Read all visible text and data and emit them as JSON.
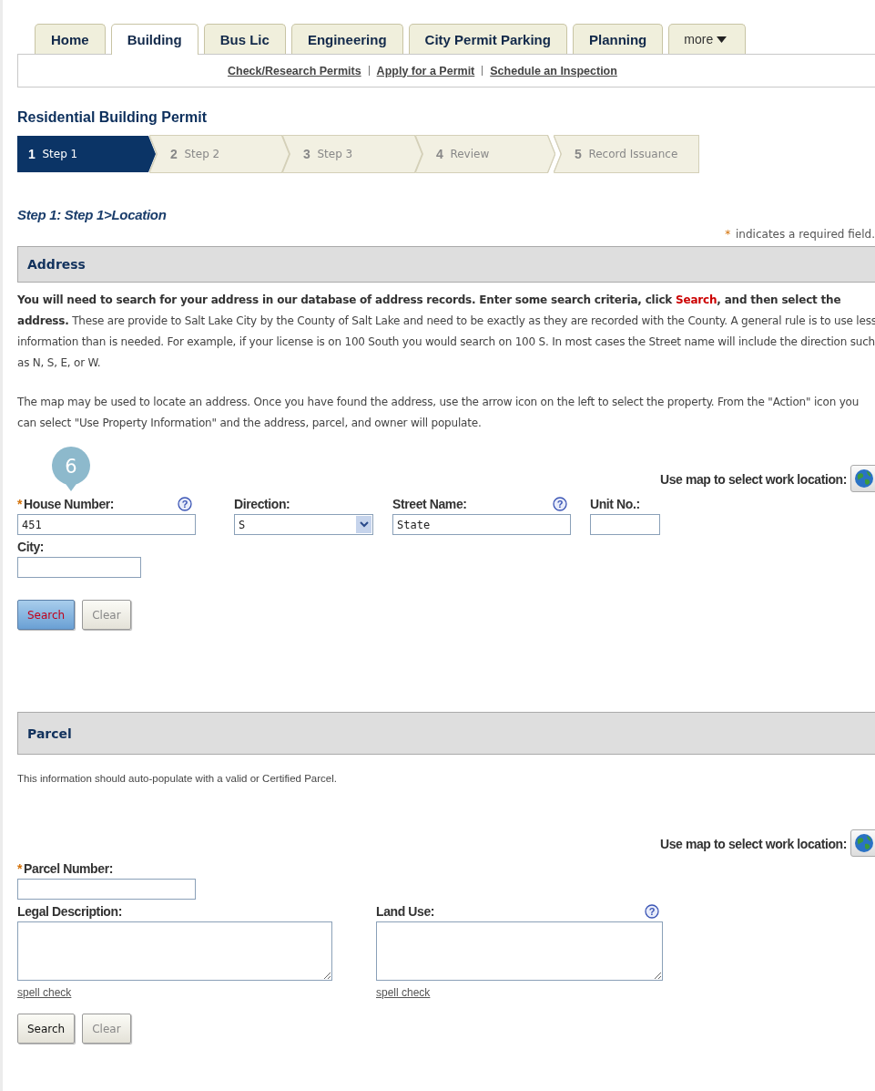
{
  "tabs": [
    {
      "label": "Home",
      "selected": false,
      "dropdown": false
    },
    {
      "label": "Building",
      "selected": true,
      "dropdown": false
    },
    {
      "label": "Bus Lic",
      "selected": false,
      "dropdown": false
    },
    {
      "label": "Engineering",
      "selected": false,
      "dropdown": false
    },
    {
      "label": "City Permit Parking",
      "selected": false,
      "dropdown": false
    },
    {
      "label": "Planning",
      "selected": false,
      "dropdown": false
    },
    {
      "label": "more",
      "selected": false,
      "dropdown": true
    }
  ],
  "sub_links": [
    "Check/Research Permits",
    "Apply for a Permit",
    "Schedule an Inspection"
  ],
  "page_title": "Residential Building Permit",
  "steps": [
    {
      "number": "1",
      "label": "Step 1",
      "selected": true
    },
    {
      "number": "2",
      "label": "Step 2",
      "selected": false
    },
    {
      "number": "3",
      "label": "Step 3",
      "selected": false
    },
    {
      "number": "4",
      "label": "Review",
      "selected": false
    },
    {
      "number": "5",
      "label": "Record Issuance",
      "selected": false
    }
  ],
  "step_heading": "Step 1: Step 1>Location",
  "required_note": {
    "mark": "*",
    "text": "indicates a required field."
  },
  "address": {
    "title": "Address",
    "paragraphs": [
      [
        {
          "text": "You will need to search for your address in our database of address records. Enter some search criteria, click ",
          "kind": "strong"
        },
        {
          "text": "Search",
          "kind": "alert"
        },
        {
          "text": ", and then select the address.",
          "kind": "strong"
        },
        {
          "text": " These are provide to Salt Lake City by the County of Salt Lake and need to be exactly as they are recorded with the County. A general rule is to use less information than is needed. For example, if your license is on 100 South you would search on 100 S. In most cases the Street name will include the direction such as N, S, E, or W.",
          "kind": "normal"
        }
      ],
      [
        {
          "text": "The map may be used to locate an address. Once you have found the address, use the arrow icon on the left to select the property. From the \"Action\" icon you can select \"Use Property Information\" and the address, parcel, and owner will populate.",
          "kind": "normal"
        }
      ]
    ],
    "badge": "6",
    "map_link": "Use map to select work location:",
    "rows": [
      [
        {
          "label": "House Number:",
          "required": true,
          "help": "?",
          "kind": "text",
          "value": "451"
        },
        {
          "label": "Direction:",
          "required": false,
          "kind": "select",
          "value": "S"
        },
        {
          "label": "Street Name:",
          "required": false,
          "help": "?",
          "kind": "text",
          "value": "State"
        },
        {
          "label": "Unit No.:",
          "required": false,
          "kind": "text"
        }
      ],
      [
        {
          "label": "City:",
          "required": false,
          "kind": "text"
        }
      ]
    ],
    "buttons": [
      {
        "label": "Search",
        "highlighted": true
      },
      {
        "label": "Clear",
        "highlighted": false
      }
    ]
  },
  "parcel": {
    "title": "Parcel",
    "note": "This information should auto-populate with a valid or Certified Parcel.",
    "map_link": "Use map to select work location:",
    "rows": [
      [
        {
          "label": "Parcel Number:",
          "required": true,
          "kind": "text"
        }
      ],
      [
        {
          "label": "Legal Description:",
          "required": false,
          "kind": "textarea",
          "spell_check": "spell check"
        },
        {
          "label": "Land Use:",
          "required": false,
          "help": "?",
          "kind": "textarea",
          "spell_check": "spell check"
        }
      ]
    ],
    "buttons": [
      {
        "label": "Search",
        "highlighted": false
      },
      {
        "label": "Clear",
        "highlighted": false
      }
    ]
  }
}
